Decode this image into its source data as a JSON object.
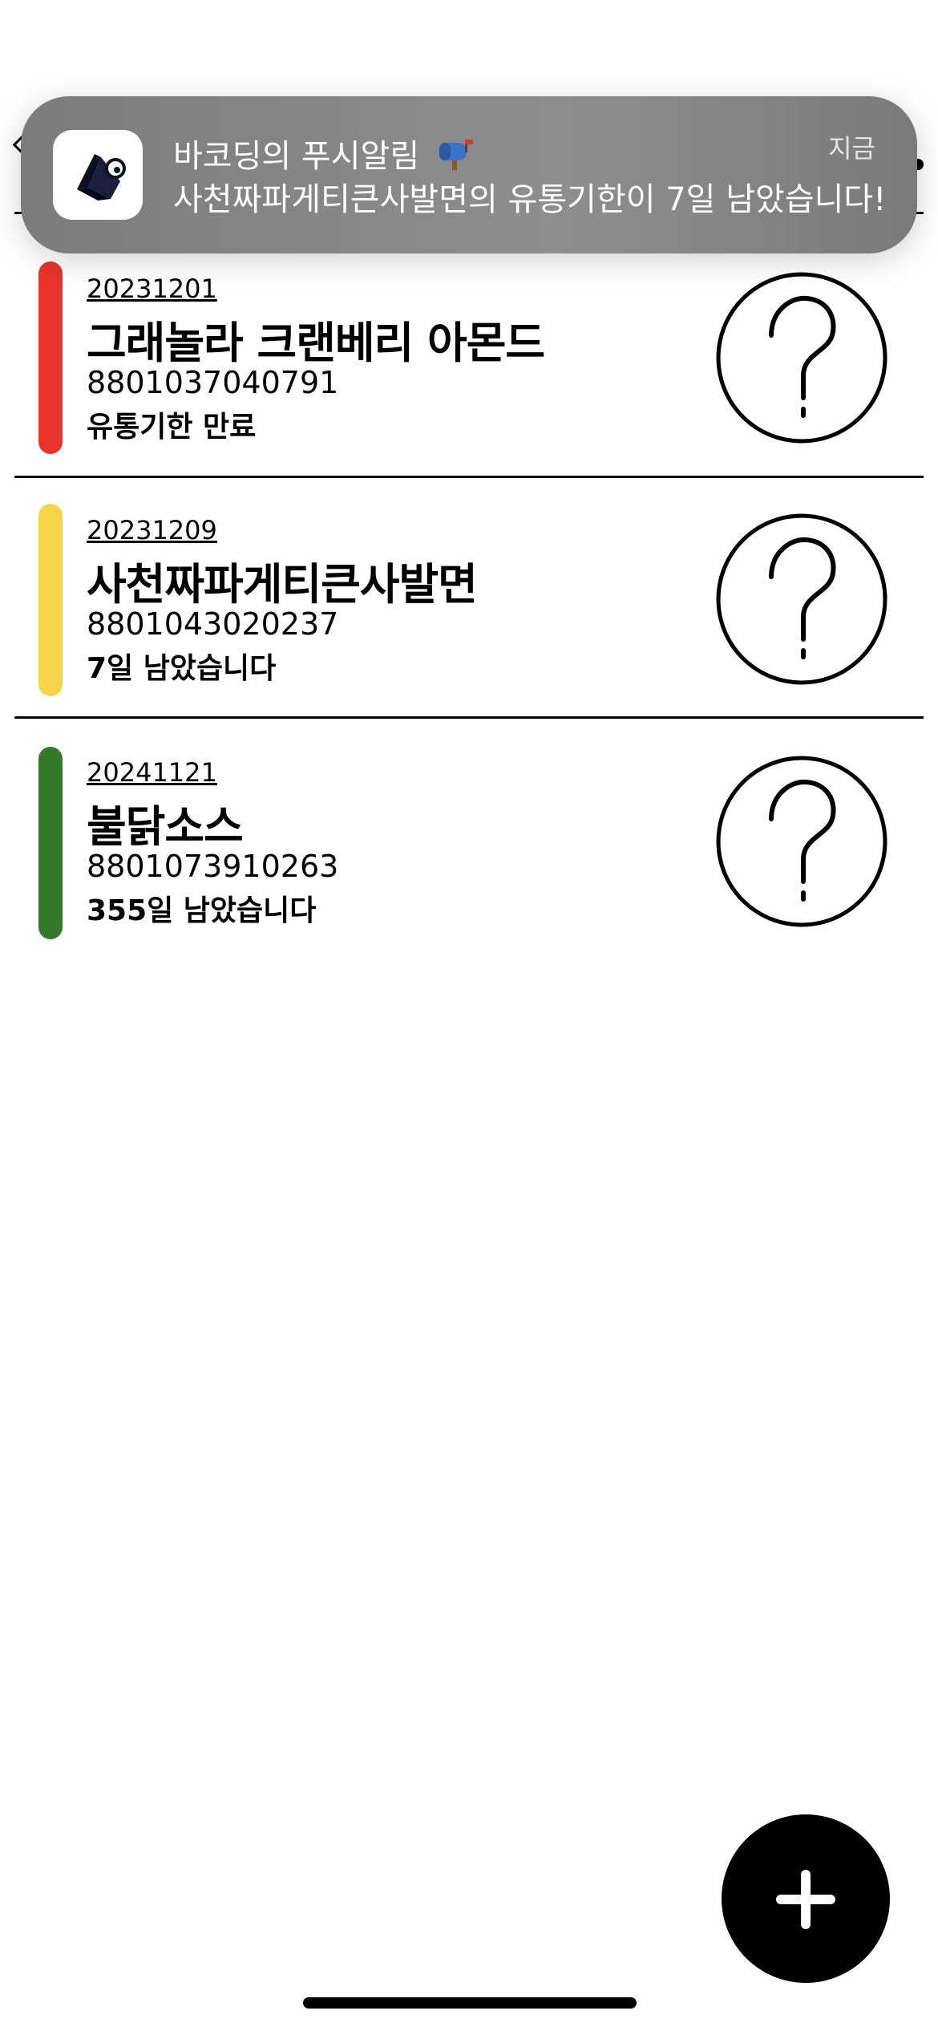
{
  "notification": {
    "app_name": "바코딩의 푸시알림",
    "app_name_emoji": "📭",
    "message": "사천짜파게티큰사발면의 유통기한이 7일 남았습니다!",
    "time": "지금"
  },
  "products": [
    {
      "date": "20231201",
      "name": "그래놀라 크랜베리 아몬드",
      "barcode": "8801037040791",
      "status": "유통기한 만료",
      "status_color": "#e8342a",
      "image_icon": "question-mark-icon"
    },
    {
      "date": "20231209",
      "name": "사천짜파게티큰사발면",
      "barcode": "8801043020237",
      "status": "7일 남았습니다",
      "status_color": "#f7d54a",
      "image_icon": "question-mark-icon"
    },
    {
      "date": "20241121",
      "name": "불닭소스",
      "barcode": "8801073910263",
      "status": "355일 남았습니다",
      "status_color": "#347a2a",
      "image_icon": "question-mark-icon"
    }
  ],
  "fab": {
    "icon": "plus-icon"
  }
}
